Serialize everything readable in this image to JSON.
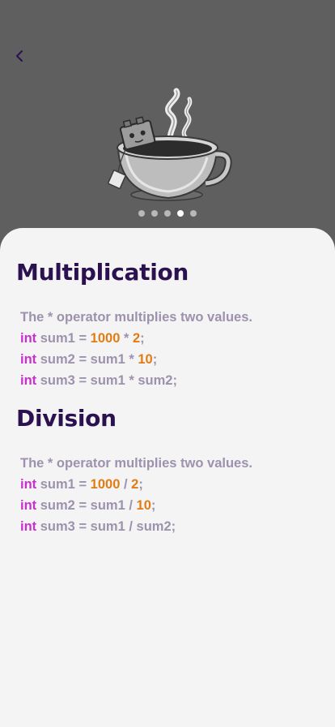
{
  "nav": {
    "back_label": "Back"
  },
  "pager": {
    "count": 5,
    "active_index": 3
  },
  "sections": [
    {
      "title": "Multiplication",
      "description": "The * operator multiplies two values.",
      "lines": [
        [
          {
            "t": "int",
            "k": "kw"
          },
          {
            "t": " sum1 = ",
            "k": "txt"
          },
          {
            "t": "1000",
            "k": "num"
          },
          {
            "t": " * ",
            "k": "txt"
          },
          {
            "t": "2",
            "k": "num"
          },
          {
            "t": ";",
            "k": "txt"
          }
        ],
        [
          {
            "t": "int",
            "k": "kw"
          },
          {
            "t": " sum2 = sum1 * ",
            "k": "txt"
          },
          {
            "t": "10",
            "k": "num"
          },
          {
            "t": ";",
            "k": "txt"
          }
        ],
        [
          {
            "t": "int",
            "k": "kw"
          },
          {
            "t": " sum3 = sum1 * sum2;",
            "k": "txt"
          }
        ]
      ]
    },
    {
      "title": "Division",
      "description": "The * operator multiplies two values.",
      "lines": [
        [
          {
            "t": "int",
            "k": "kw"
          },
          {
            "t": " sum1 = ",
            "k": "txt"
          },
          {
            "t": "1000",
            "k": "num"
          },
          {
            "t": " / ",
            "k": "txt"
          },
          {
            "t": "2",
            "k": "num"
          },
          {
            "t": ";",
            "k": "txt"
          }
        ],
        [
          {
            "t": "int",
            "k": "kw"
          },
          {
            "t": " sum2 = sum1 / ",
            "k": "txt"
          },
          {
            "t": "10",
            "k": "num"
          },
          {
            "t": ";",
            "k": "txt"
          }
        ],
        [
          {
            "t": "int",
            "k": "kw"
          },
          {
            "t": " sum3 = sum1 / sum2;",
            "k": "txt"
          }
        ]
      ]
    }
  ],
  "colors": {
    "header_bg": "#5f5f5f",
    "sheet_bg": "#f4f4f4",
    "title": "#2b1150",
    "text": "#9d92ad",
    "keyword": "#cc2fd0",
    "number": "#e27c12",
    "dot_active": "#ffffff",
    "dot_inactive": "#b8b8b8"
  },
  "icons": {
    "back": "chevron-left-icon",
    "illustration": "coffee-cup-robot-illustration"
  }
}
